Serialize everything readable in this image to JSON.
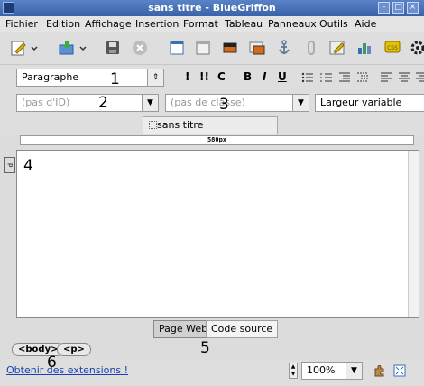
{
  "window": {
    "title": "sans titre - BlueGriffon"
  },
  "menu": [
    "Fichier",
    "Edition",
    "Affichage",
    "Insertion",
    "Format",
    "Tableau",
    "Panneaux",
    "Outils",
    "Aide"
  ],
  "format": {
    "paragraph_select": "Paragraphe",
    "bold": "B",
    "italic": "I",
    "underline": "U",
    "class_c": "C"
  },
  "row2": {
    "id_placeholder": "(pas d'ID)",
    "class_placeholder": "(pas de classe)",
    "width_select": "Largeur variable"
  },
  "tabs": {
    "document_tab": "sans titre"
  },
  "ruler": {
    "width_label": "580px"
  },
  "editor": {
    "p_marker": "p"
  },
  "view_tabs": {
    "web_page": "Page Web",
    "source": "Code source"
  },
  "breadcrumb": [
    "<body>",
    "<p>"
  ],
  "status": {
    "extensions_link": "Obtenir des extensions !",
    "zoom": "100%"
  },
  "markers": [
    "1",
    "2",
    "3",
    "4",
    "5",
    "6"
  ],
  "colors": {
    "titlebar": "#3a62a8",
    "link": "#1a3fb0"
  }
}
